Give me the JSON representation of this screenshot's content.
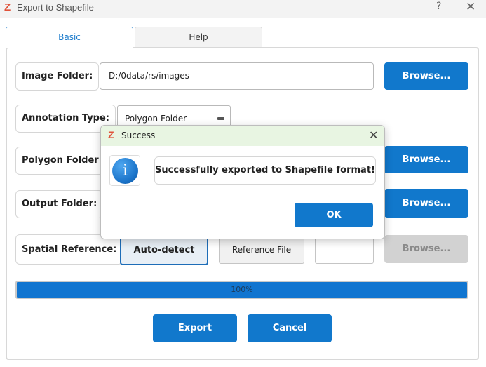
{
  "window": {
    "logo_glyph": "Z",
    "title": "Export to Shapefile",
    "help_glyph": "?",
    "close_glyph": "✕"
  },
  "tabs": [
    {
      "label": "Basic",
      "active": true
    },
    {
      "label": "Help",
      "active": false
    }
  ],
  "form": {
    "image_folder_label": "Image Folder:",
    "image_folder_value": "D:/0data/rs/images",
    "annotation_type_label": "Annotation Type:",
    "annotation_type_value": "Polygon Folder",
    "polygon_folder_label": "Polygon Folder:",
    "output_folder_label": "Output Folder:",
    "spatial_reference_label": "Spatial Reference:",
    "spatial_reference_options": [
      "Auto-detect",
      "Reference File"
    ],
    "spatial_reference_selected": "Auto-detect",
    "browse_label": "Browse..."
  },
  "progress": {
    "value": 1.0,
    "text": "100%"
  },
  "actions": {
    "export_label": "Export",
    "cancel_label": "Cancel"
  },
  "dialog": {
    "logo_glyph": "Z",
    "title": "Success",
    "close_glyph": "✕",
    "icon": "info-icon",
    "icon_glyph": "i",
    "message": "Successfully exported to Shapefile format!",
    "ok_label": "OK"
  },
  "colors": {
    "accent": "#1178cc",
    "dialog_titlebar": "#e8f5e2",
    "logo": "#e0523a",
    "disabled_button": "#d2d2d2"
  }
}
